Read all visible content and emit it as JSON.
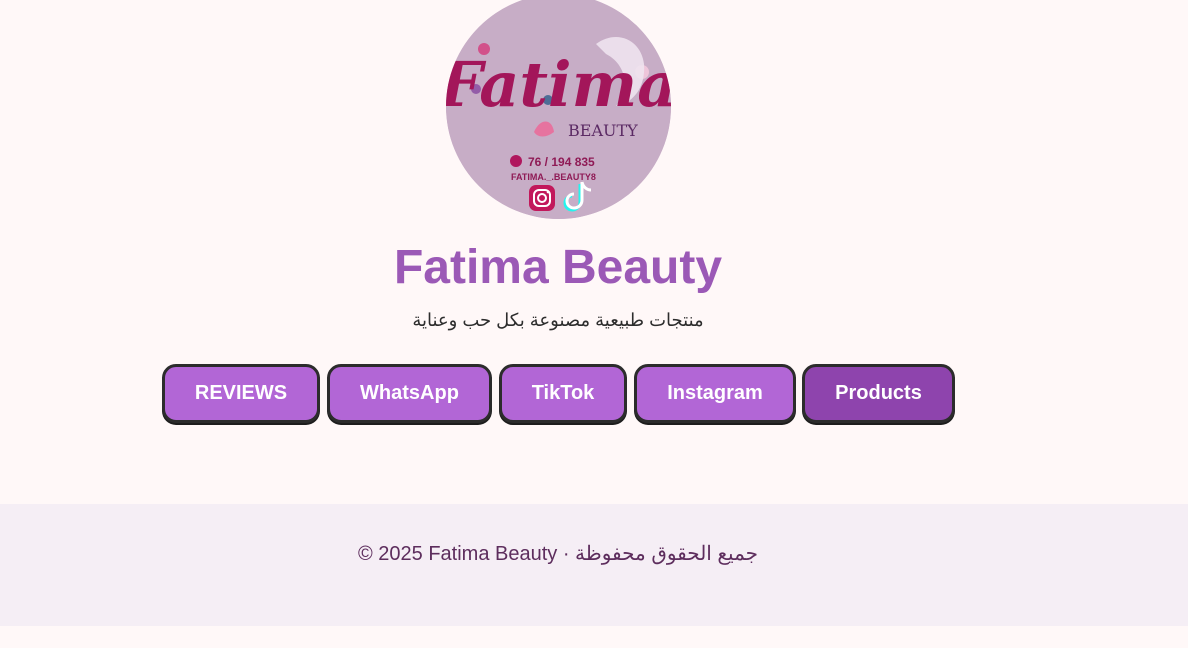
{
  "brand": {
    "name": "Fatima Beauty",
    "tagline": "منتجات طبيعية مصنوعة بكل حب وعناية",
    "logo": {
      "word": "Fatima",
      "subword": "BEAUTY",
      "phone": "76 / 194 835",
      "handle": "FATIMA._.BEAUTY8",
      "social_icons": [
        "instagram-icon",
        "tiktok-icon"
      ]
    }
  },
  "nav": {
    "items": [
      {
        "label": "REVIEWS"
      },
      {
        "label": "WhatsApp"
      },
      {
        "label": "TikTok"
      },
      {
        "label": "Instagram"
      },
      {
        "label": "Products"
      }
    ]
  },
  "footer": {
    "text": "© 2025 Fatima Beauty · جميع الحقوق محفوظة"
  },
  "colors": {
    "accent": "#9b59b6",
    "button": "#b266d6",
    "button_active": "#8e44ad",
    "page_bg": "#fff8f8",
    "footer_bg": "#f5eef5"
  }
}
